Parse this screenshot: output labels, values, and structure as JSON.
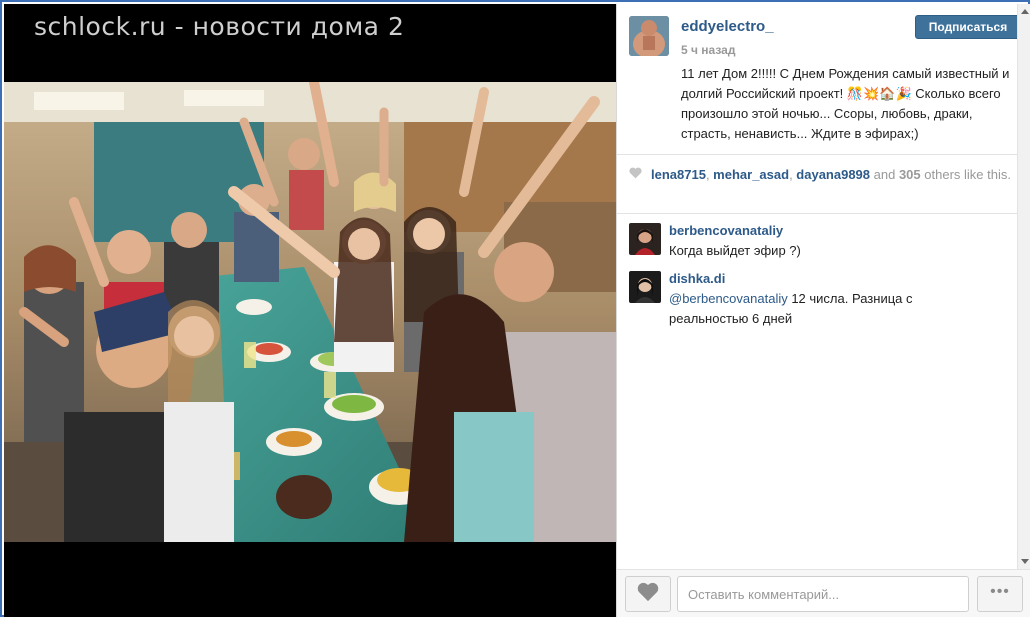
{
  "watermark": "schlock.ru - новости дома 2",
  "post": {
    "username": "eddyelectro_",
    "time_ago": "5 ч назад",
    "follow_label": "Подписаться",
    "caption": "11 лет Дом 2!!!!! С Днем Рождения самый известный и долгий Российский проект! 🎊💥🏠🎉 Сколько всего произошло этой ночью... Ссоры, любовь, драки, страсть, ненависть... Ждите в эфирах;)"
  },
  "likes": {
    "users": [
      "lena8715",
      "mehar_asad",
      "dayana9898"
    ],
    "sep": ", ",
    "and_word": " and ",
    "count": "305",
    "suffix": " others like this."
  },
  "comments": [
    {
      "username": "berbencovanataliy",
      "text": "Когда выйдет эфир ?)"
    },
    {
      "username": "dishka.di",
      "mention": "@berbencovanataliy",
      "text": " 12 числа. Разница с реальностью 6 дней"
    }
  ],
  "footer": {
    "comment_placeholder": "Оставить комментарий...",
    "more_label": "•••"
  },
  "icons": {
    "like": "heart-icon",
    "likes_heart": "heart-icon",
    "scroll_up": "arrow-up-icon",
    "scroll_down": "arrow-down-icon"
  },
  "colors": {
    "frame": "#3d6fb6",
    "link": "#2d5a89",
    "follow_button": "#3f729b",
    "muted": "#999999"
  }
}
